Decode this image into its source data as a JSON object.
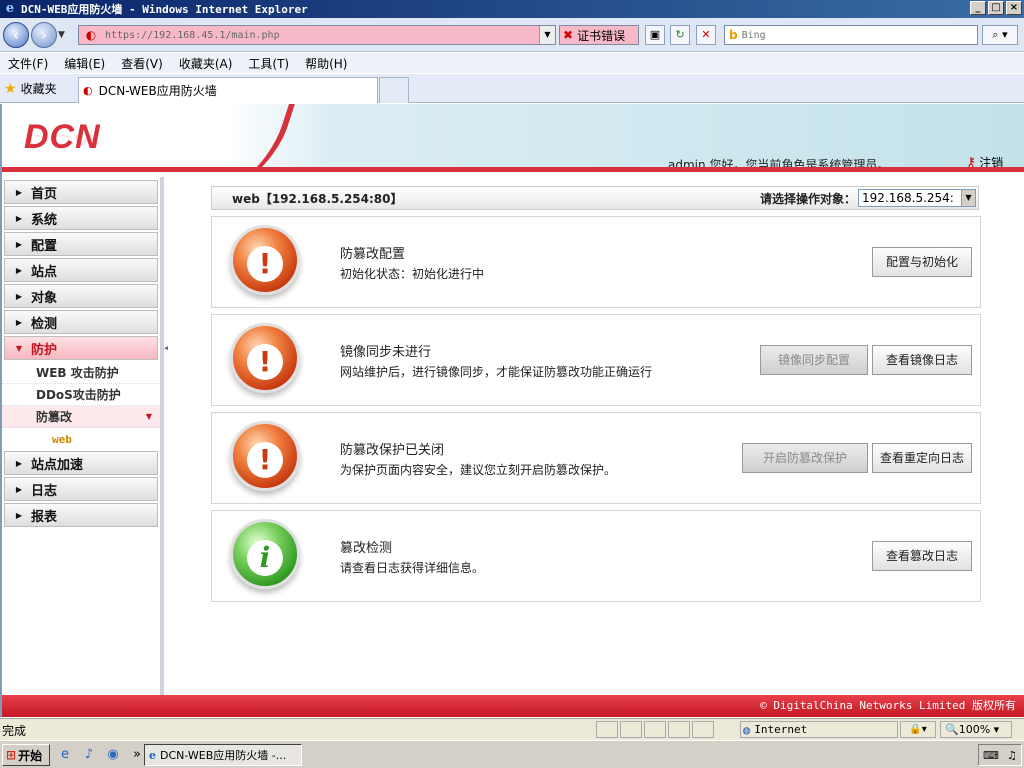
{
  "window": {
    "title": "DCN-WEB应用防火墙 - Windows Internet Explorer",
    "controls": [
      "_",
      "□",
      "×"
    ]
  },
  "browser": {
    "url": "https://192.168.45.1/main.php",
    "cert_error": "证书错误",
    "search_placeholder": "Bing",
    "menu": [
      "文件(F)",
      "编辑(E)",
      "查看(V)",
      "收藏夹(A)",
      "工具(T)",
      "帮助(H)"
    ],
    "favorites_label": "收藏夹",
    "tab_title": "DCN-WEB应用防火墙"
  },
  "banner": {
    "logo": "DCN",
    "welcome": "admin 您好，您当前角色是系统管理员。",
    "logout": "注销"
  },
  "sidebar": {
    "items": [
      {
        "label": "首页"
      },
      {
        "label": "系统"
      },
      {
        "label": "配置"
      },
      {
        "label": "站点"
      },
      {
        "label": "对象"
      },
      {
        "label": "检测"
      },
      {
        "label": "防护",
        "expanded": true
      }
    ],
    "protection_sub": [
      "WEB 攻击防护",
      "DDoS攻击防护",
      "防篡改"
    ],
    "tamper_sub": [
      "web"
    ],
    "items_after": [
      {
        "label": "站点加速"
      },
      {
        "label": "日志"
      },
      {
        "label": "报表"
      }
    ]
  },
  "main": {
    "target": "web【192.168.5.254:80】",
    "select_label": "请选择操作对象：",
    "select_value": "192.168.5.254:",
    "panels": [
      {
        "icon": "warning-icon",
        "title": "防篡改配置",
        "desc": "初始化状态：初始化进行中",
        "buttons": [
          {
            "label": "配置与初始化",
            "disabled": false
          }
        ]
      },
      {
        "icon": "warning-icon",
        "title": "镜像同步未进行",
        "desc": "网站维护后，进行镜像同步，才能保证防篡改功能正确运行",
        "buttons": [
          {
            "label": "镜像同步配置",
            "disabled": true
          },
          {
            "label": "查看镜像日志",
            "disabled": false
          }
        ]
      },
      {
        "icon": "warning-icon",
        "title": "防篡改保护已关闭",
        "desc": "为保护页面内容安全，建议您立刻开启防篡改保护。",
        "buttons": [
          {
            "label": "开启防篡改保护",
            "disabled": true
          },
          {
            "label": "查看重定向日志",
            "disabled": false
          }
        ]
      },
      {
        "icon": "info-icon",
        "title": "篡改检测",
        "desc": "请查看日志获得详细信息。",
        "buttons": [
          {
            "label": "查看篡改日志",
            "disabled": false
          }
        ]
      }
    ]
  },
  "footer": "© DigitalChina Networks Limited 版权所有",
  "statusbar": {
    "status": "完成",
    "zone": "Internet",
    "zoom": "100%"
  },
  "taskbar": {
    "start": "开始",
    "task_item": "DCN-WEB应用防火墙 -..."
  },
  "colors": {
    "brand_red": "#d7313b",
    "banner_teal": "#c3e2ea"
  }
}
